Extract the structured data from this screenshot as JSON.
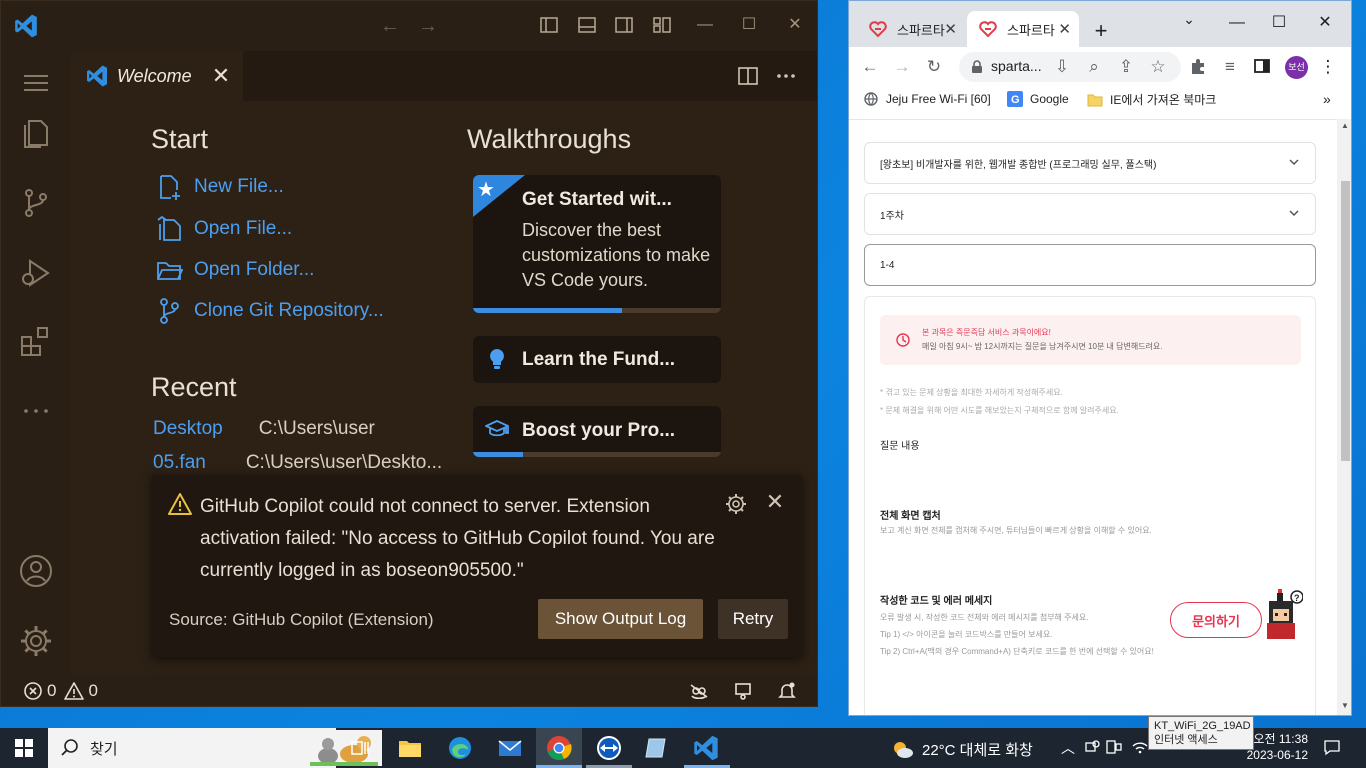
{
  "vscode": {
    "tab": {
      "label": "Welcome"
    },
    "start": {
      "title": "Start",
      "items": [
        {
          "label": "New File...",
          "icon": "new-file-icon"
        },
        {
          "label": "Open File...",
          "icon": "open-file-icon"
        },
        {
          "label": "Open Folder...",
          "icon": "open-folder-icon"
        },
        {
          "label": "Clone Git Repository...",
          "icon": "git-clone-icon"
        }
      ]
    },
    "recent": {
      "title": "Recent",
      "items": [
        {
          "name": "Desktop",
          "path": "C:\\Users\\user"
        },
        {
          "name": "05.fan",
          "path": "C:\\Users\\user\\Deskto..."
        }
      ]
    },
    "walkthroughs": {
      "title": "Walkthroughs",
      "cards": [
        {
          "title": "Get Started wit...",
          "desc": "Discover the best customizations to make VS Code yours.",
          "progress": 0.6
        },
        {
          "title": "Learn the Fund...",
          "progress": 0
        },
        {
          "title": "Boost your Pro...",
          "progress": 0.2
        }
      ]
    },
    "notification": {
      "message": "GitHub Copilot could not connect to server. Extension activation failed: \"No access to GitHub Copilot found. You are currently logged in as boseon905500.\"",
      "source": "Source: GitHub Copilot (Extension)",
      "primary_button": "Show Output Log",
      "secondary_button": "Retry"
    },
    "statusbar": {
      "errors": "0",
      "warnings": "0"
    },
    "colors": {
      "accent": "#4c9ff0",
      "background": "#2d2116",
      "button": "#6b5337"
    }
  },
  "chrome": {
    "tabs": [
      {
        "title": "스파르타",
        "active": false
      },
      {
        "title": "스파르타",
        "active": true
      }
    ],
    "omnibox": {
      "text": "sparta..."
    },
    "profile": {
      "initials": "보선"
    },
    "bookmarks": [
      {
        "label": "Jeju Free Wi-Fi [60]"
      },
      {
        "label": "Google"
      },
      {
        "label": "IE에서 가져온 북마크"
      }
    ],
    "page": {
      "course_select": "[왕초보] 비개발자를 위한, 웹개발 종합반 (프로그래밍 실무, 풀스택)",
      "week_select": "1주차",
      "lesson_input": "1-4",
      "alert_title": "본 과목은 즉문즉답 서비스 과목이에요!",
      "alert_sub": "매일 아침 9시~ 밤 12시까지는 질문을 남겨주시면 10분 내 답변해드려요.",
      "hint1": "* 겪고 있는 문제 상황을 최대한 자세하게 작성해주세요.",
      "hint2": "* 문제 해결을 위해 어떤 시도를 해보았는지 구체적으로 함께 알려주세요.",
      "question_label": "질문 내용",
      "capture_label": "전체 화면 캡처",
      "capture_sub": "보고 계신 화면 전체를 캡처해 주시면, 튜터님들이 빠르게 상황을 이해할 수 있어요.",
      "code_label": "작성한 코드 및 에러 메세지",
      "code_sub1": "오류 발생 시, 작성한 코드 전체와 에러 메시지를 첨부해 주세요.",
      "code_sub2": "Tip 1) </> 아이콘을 눌러 코드박스를 만들어 보세요.",
      "code_sub3": "Tip 2) Ctrl+A(맥의 경우 Command+A) 단축키로 코드를 한 번에 선택할 수 있어요!",
      "ask_button": "문의하기"
    }
  },
  "taskbar": {
    "search_placeholder": "찾기",
    "weather": "22°C  대체로 화창",
    "time": "오전 11:38",
    "date": "2023-06-12",
    "wifi_tooltip_line1": "KT_WiFi_2G_19AD",
    "wifi_tooltip_line2": "인터넷 액세스"
  }
}
